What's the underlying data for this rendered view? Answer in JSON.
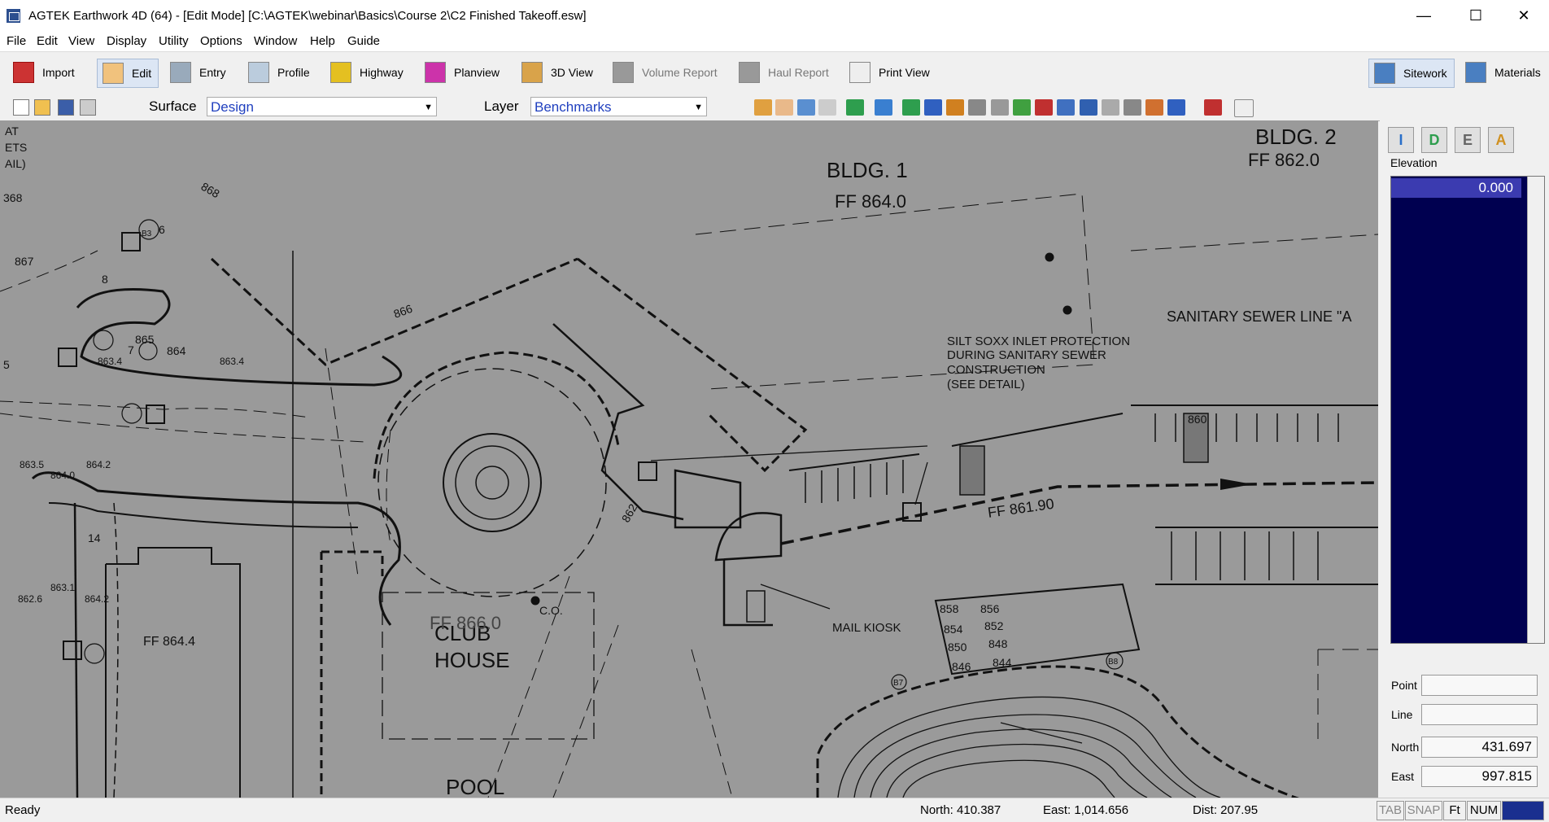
{
  "window": {
    "title": "AGTEK Earthwork 4D (64) - [Edit Mode]  [C:\\AGTEK\\webinar\\Basics\\Course 2\\C2 Finished Takeoff.esw]",
    "minimize": "—",
    "maximize": "☐",
    "close": "✕"
  },
  "menu": [
    "File",
    "Edit",
    "View",
    "Display",
    "Utility",
    "Options",
    "Window",
    "Help",
    "Guide"
  ],
  "modes": {
    "import": "Import",
    "edit": "Edit",
    "entry": "Entry",
    "profile": "Profile",
    "highway": "Highway",
    "planview": "Planview",
    "view3d": "3D View",
    "volume_report": "Volume Report",
    "haul_report": "Haul Report",
    "print_view": "Print View",
    "sitework": "Sitework",
    "materials": "Materials"
  },
  "toolbar2": {
    "surface_label": "Surface",
    "surface_value": "Design",
    "layer_label": "Layer",
    "layer_value": "Benchmarks"
  },
  "drawing": {
    "bldg1": "BLDG. 1",
    "ff1": "FF 864.0",
    "bldg2": "BLDG. 2",
    "ff2": "FF 862.0",
    "sewer": "SANITARY SEWER LINE \"A",
    "silt1": "SILT SOXX INLET PROTECTION",
    "silt2": "DURING SANITARY SEWER",
    "silt3": "CONSTRUCTION",
    "silt4": "(SEE DETAIL)",
    "ff3": "FF 861.90",
    "club1": "CLUB",
    "club2": "HOUSE",
    "ff_club": "FF 866.0",
    "ff4": "FF 864.4",
    "mail": "MAIL KIOSK",
    "co": "C.O.",
    "pool": "POOL",
    "at": "AT",
    "ets": "ETS",
    "ail": "AIL)",
    "c1": "867",
    "c2": "866",
    "c3": "865",
    "c4": "864",
    "c5": "868",
    "c6": "860",
    "c7": "862",
    "c8": "858",
    "c9": "856",
    "c10": "854",
    "c11": "852",
    "c12": "850",
    "c13": "848",
    "c14": "846",
    "c15": "844",
    "s1": "863.4",
    "s2": "863.4",
    "s3": "863.5",
    "s4": "864.2",
    "s5": "864.0",
    "s6": "862.6",
    "s7": "864.2",
    "s8": "863.1",
    "n6": "6",
    "n7": "7",
    "n8": "8",
    "n14": "14",
    "b3": "B3",
    "b7": "B7",
    "b8": "B8",
    "c368": "368",
    "c5b": "5"
  },
  "side": {
    "tab_i": "I",
    "tab_d": "D",
    "tab_e": "E",
    "tab_a": "A",
    "elevation_label": "Elevation",
    "elevation_value": "0.000",
    "point_label": "Point",
    "point_value": "",
    "line_label": "Line",
    "line_value": "",
    "north_label": "North",
    "north_value": "431.697",
    "east_label": "East",
    "east_value": "997.815"
  },
  "status": {
    "ready": "Ready",
    "north": "North: 410.387",
    "east": "East: 1,014.656",
    "dist": "Dist: 207.95",
    "tab": "TAB",
    "snap": "SNAP",
    "ft": "Ft",
    "num": "NUM"
  }
}
